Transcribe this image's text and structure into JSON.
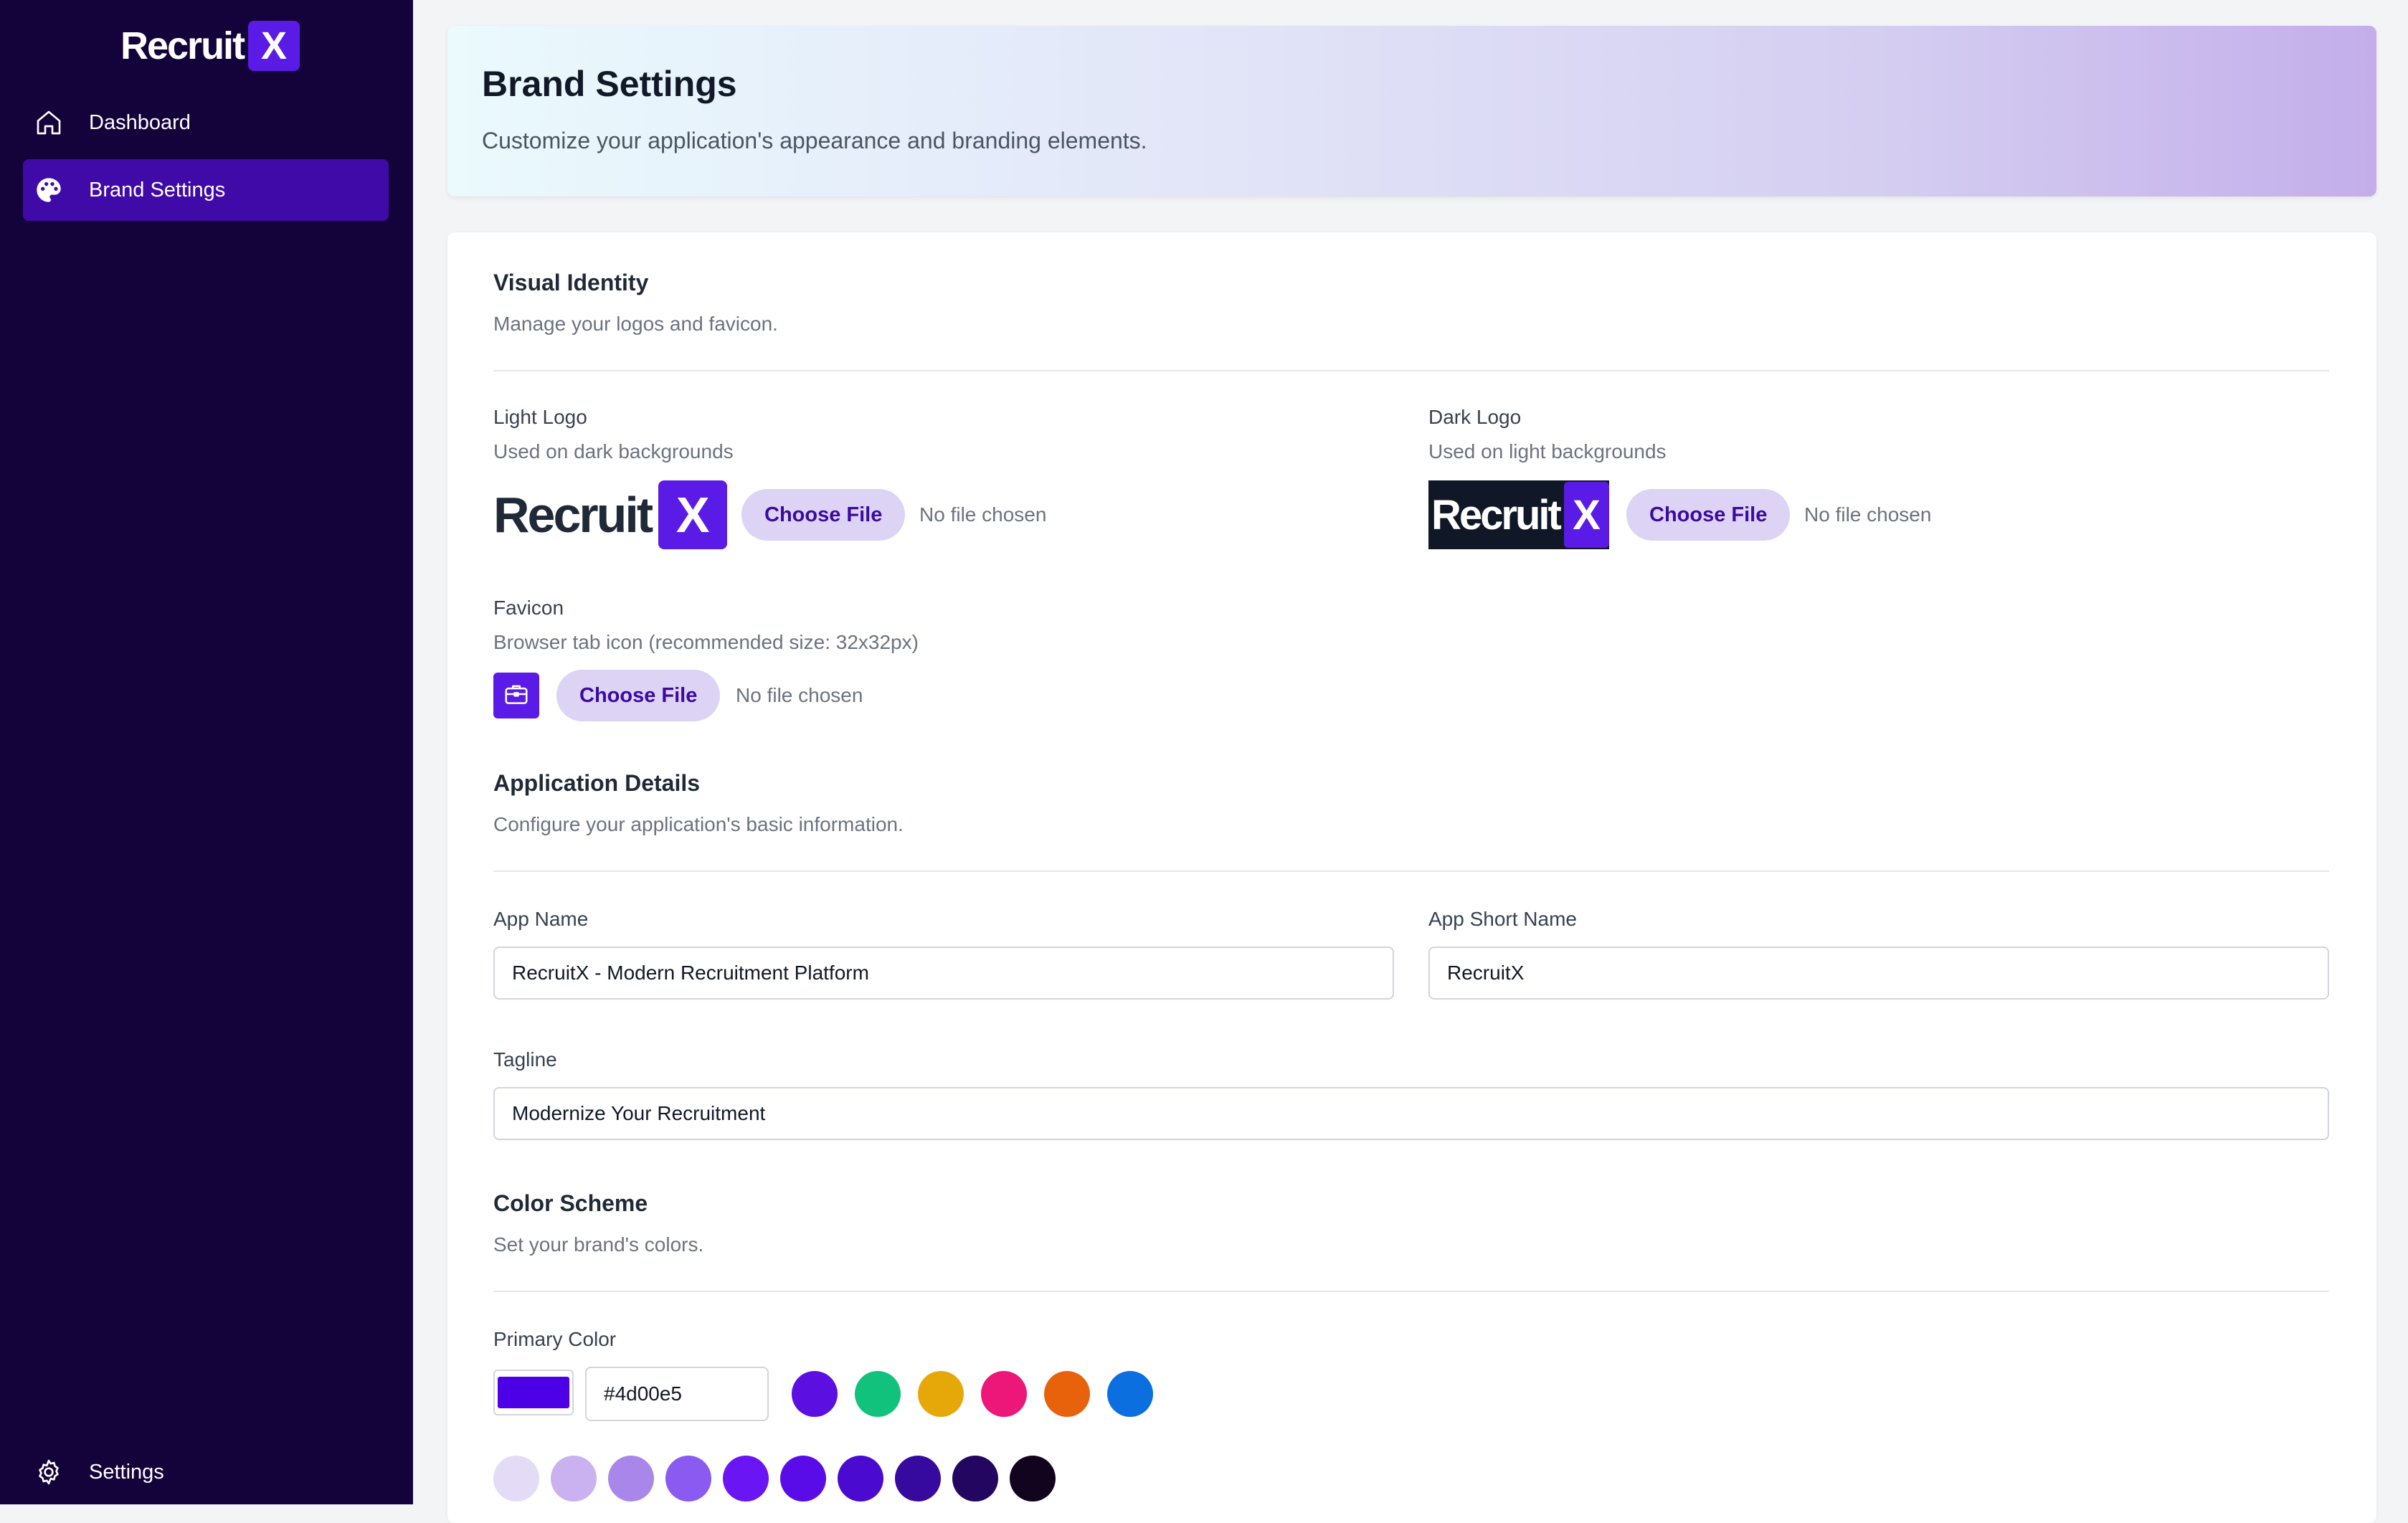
{
  "sidebar": {
    "logo_text": "Recruit",
    "logo_mark": "X",
    "items": [
      {
        "label": "Dashboard",
        "icon": "home-icon",
        "active": false
      },
      {
        "label": "Brand Settings",
        "icon": "palette-icon",
        "active": true
      }
    ],
    "footer_item": {
      "label": "Settings",
      "icon": "gear-icon"
    }
  },
  "header": {
    "title": "Brand Settings",
    "subtitle": "Customize your application's appearance and branding elements."
  },
  "visual_identity": {
    "title": "Visual Identity",
    "subtitle": "Manage your logos and favicon.",
    "light_logo": {
      "label": "Light Logo",
      "hint": "Used on dark backgrounds",
      "preview_word": "Recruit",
      "preview_mark": "X",
      "button": "Choose File",
      "file_status": "No file chosen"
    },
    "dark_logo": {
      "label": "Dark Logo",
      "hint": "Used on light backgrounds",
      "preview_word": "Recruit",
      "preview_mark": "X",
      "button": "Choose File",
      "file_status": "No file chosen"
    },
    "favicon": {
      "label": "Favicon",
      "hint": "Browser tab icon (recommended size: 32x32px)",
      "icon": "briefcase-icon",
      "button": "Choose File",
      "file_status": "No file chosen"
    }
  },
  "app_details": {
    "title": "Application Details",
    "subtitle": "Configure your application's basic information.",
    "app_name": {
      "label": "App Name",
      "value": "RecruitX - Modern Recruitment Platform"
    },
    "app_short_name": {
      "label": "App Short Name",
      "value": "RecruitX"
    },
    "tagline": {
      "label": "Tagline",
      "value": "Modernize Your Recruitment"
    }
  },
  "color_scheme": {
    "title": "Color Scheme",
    "subtitle": "Set your brand's colors.",
    "primary_color": {
      "label": "Primary Color",
      "value": "#4d00e5",
      "presets": [
        "#5b0fe0",
        "#10c27c",
        "#e6a808",
        "#ec1779",
        "#e8620c",
        "#0b6fe0"
      ],
      "shades": [
        "#e4dcf6",
        "#c9b2ef",
        "#a987ea",
        "#8b5af0",
        "#6a16f4",
        "#5a0ce8",
        "#4b0ad0",
        "#360a9e",
        "#230660",
        "#12041f"
      ]
    }
  },
  "colors": {
    "sidebar_bg": "#14023a",
    "active_nav": "#3f0aa8",
    "brand": "#5b1be6"
  }
}
